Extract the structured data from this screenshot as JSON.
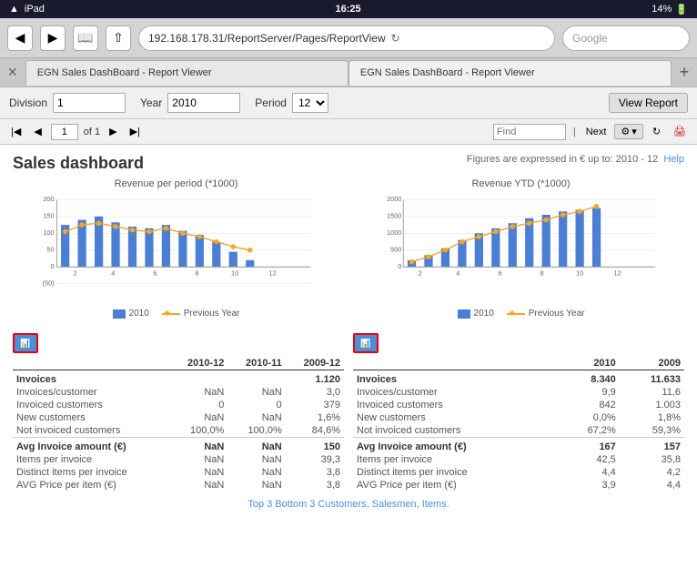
{
  "statusBar": {
    "wifi": "iPad",
    "time": "16:25",
    "battery": "14%"
  },
  "browser": {
    "url": "192.168.178.31/ReportServer/Pages/ReportView",
    "search_placeholder": "Google"
  },
  "tabs": [
    {
      "label": "EGN Sales DashBoard - Report Viewer",
      "active": false
    },
    {
      "label": "EGN Sales DashBoard - Report Viewer",
      "active": true
    }
  ],
  "reportToolbar": {
    "division_label": "Division",
    "division_value": "1",
    "year_label": "Year",
    "year_value": "2010",
    "period_label": "Period",
    "period_value": "12",
    "view_report_btn": "View Report"
  },
  "pageNav": {
    "page_value": "1",
    "of_label": "of 1",
    "find_placeholder": "Find",
    "next_label": "Next"
  },
  "report": {
    "title": "Sales dashboard",
    "subtitle": "Figures are expressed in € up to: 2010 - 12",
    "help_label": "Help",
    "chart1": {
      "title": "Revenue per period (*1000)",
      "y_labels": [
        "200",
        "150",
        "100",
        "50",
        "0",
        "(50)"
      ],
      "x_labels": [
        "2",
        "4",
        "6",
        "8",
        "10",
        "12"
      ],
      "legend_2010": "2010",
      "legend_prev": "Previous Year"
    },
    "chart2": {
      "title": "Revenue YTD (*1000)",
      "y_labels": [
        "2000",
        "1500",
        "1000",
        "500",
        "0"
      ],
      "x_labels": [
        "2",
        "4",
        "6",
        "8",
        "10",
        "12"
      ],
      "legend_2010": "2010",
      "legend_prev": "Previous Year"
    },
    "table1": {
      "col1": "2010-12",
      "col2": "2010-11",
      "col3": "2009-12",
      "sections": [
        {
          "header": "Invoices",
          "header_val1": "",
          "header_val2": "",
          "header_val3": "1.120",
          "rows": [
            {
              "label": "Invoices/customer",
              "v1": "NaN",
              "v2": "NaN",
              "v3": "3,0"
            },
            {
              "label": "Invoiced customers",
              "v1": "0",
              "v2": "0",
              "v3": "379"
            },
            {
              "label": "New customers",
              "v1": "NaN",
              "v2": "NaN",
              "v3": "1,6%"
            },
            {
              "label": "Not invoiced customers",
              "v1": "100,0%",
              "v2": "100,0%",
              "v3": "84,6%"
            }
          ]
        },
        {
          "header": "Avg Invoice amount (€)",
          "header_val1": "NaN",
          "header_val2": "NaN",
          "header_val3": "150",
          "rows": [
            {
              "label": "Items per invoice",
              "v1": "NaN",
              "v2": "NaN",
              "v3": "39,3"
            },
            {
              "label": "Distinct items per invoice",
              "v1": "NaN",
              "v2": "NaN",
              "v3": "3,8"
            },
            {
              "label": "AVG Price per item (€)",
              "v1": "NaN",
              "v2": "NaN",
              "v3": "3,8"
            }
          ]
        }
      ]
    },
    "table2": {
      "col1": "2010",
      "col2": "2009",
      "sections": [
        {
          "header": "Invoices",
          "header_val1": "8.340",
          "header_val2": "11.633",
          "rows": [
            {
              "label": "Invoices/customer",
              "v1": "9,9",
              "v2": "11,6"
            },
            {
              "label": "Invoiced customers",
              "v1": "842",
              "v2": "1.003"
            },
            {
              "label": "New customers",
              "v1": "0,0%",
              "v2": "1,8%"
            },
            {
              "label": "Not invoiced customers",
              "v1": "67,2%",
              "v2": "59,3%"
            }
          ]
        },
        {
          "header": "Avg Invoice amount (€)",
          "header_val1": "167",
          "header_val2": "157",
          "rows": [
            {
              "label": "Items per invoice",
              "v1": "42,5",
              "v2": "35,8"
            },
            {
              "label": "Distinct items per invoice",
              "v1": "4,4",
              "v2": "4,2"
            },
            {
              "label": "AVG Price per item (€)",
              "v1": "3,9",
              "v2": "4,4"
            }
          ]
        }
      ]
    },
    "footer_link": "Top 3 Bottom 3 Customers, Salesmen, Items."
  }
}
